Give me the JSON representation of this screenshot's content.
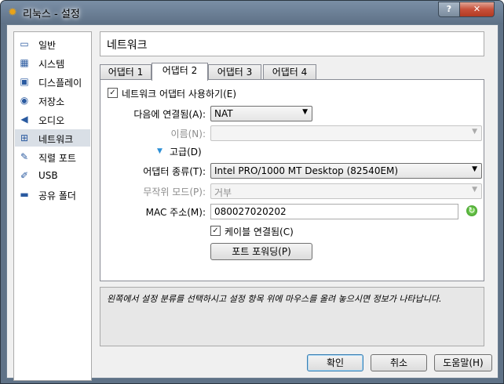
{
  "window": {
    "title": "리눅스 - 설정",
    "help_label": "?",
    "close_label": "✕"
  },
  "sidebar": {
    "items": [
      {
        "label": "일반",
        "icon": "▭"
      },
      {
        "label": "시스템",
        "icon": "▦"
      },
      {
        "label": "디스플레이",
        "icon": "▣"
      },
      {
        "label": "저장소",
        "icon": "◉"
      },
      {
        "label": "오디오",
        "icon": "◀"
      },
      {
        "label": "네트워크",
        "icon": "⊞"
      },
      {
        "label": "직렬 포트",
        "icon": "✎"
      },
      {
        "label": "USB",
        "icon": "✐"
      },
      {
        "label": "공유 폴더",
        "icon": "▬"
      }
    ],
    "selected": "네트워크"
  },
  "page_title": "네트워크",
  "tabs": [
    "어댑터 1",
    "어댑터 2",
    "어댑터 3",
    "어댑터 4"
  ],
  "active_tab": "어댑터 2",
  "form": {
    "enable_adapter": {
      "label": "네트워크 어댑터 사용하기(E)",
      "checked": true
    },
    "attached_to": {
      "label": "다음에 연결됨(A):",
      "value": "NAT"
    },
    "name": {
      "label": "이름(N):",
      "value": ""
    },
    "advanced": {
      "label": "고급(D)"
    },
    "adapter_type": {
      "label": "어댑터 종류(T):",
      "value": "Intel PRO/1000 MT Desktop (82540EM)"
    },
    "promiscuous": {
      "label": "무작위 모드(P):",
      "value": "거부"
    },
    "mac": {
      "label": "MAC 주소(M):",
      "value": "080027020202"
    },
    "cable_connected": {
      "label": "케이블 연결됨(C)",
      "checked": true
    },
    "port_forwarding_label": "포트 포워딩(P)"
  },
  "description": "왼쪽에서 설정 분류를 선택하시고 설정 항목 위에 마우스를 올려 놓으시면 정보가 나타납니다.",
  "buttons": {
    "ok": "확인",
    "cancel": "취소",
    "help": "도움말(H)"
  }
}
